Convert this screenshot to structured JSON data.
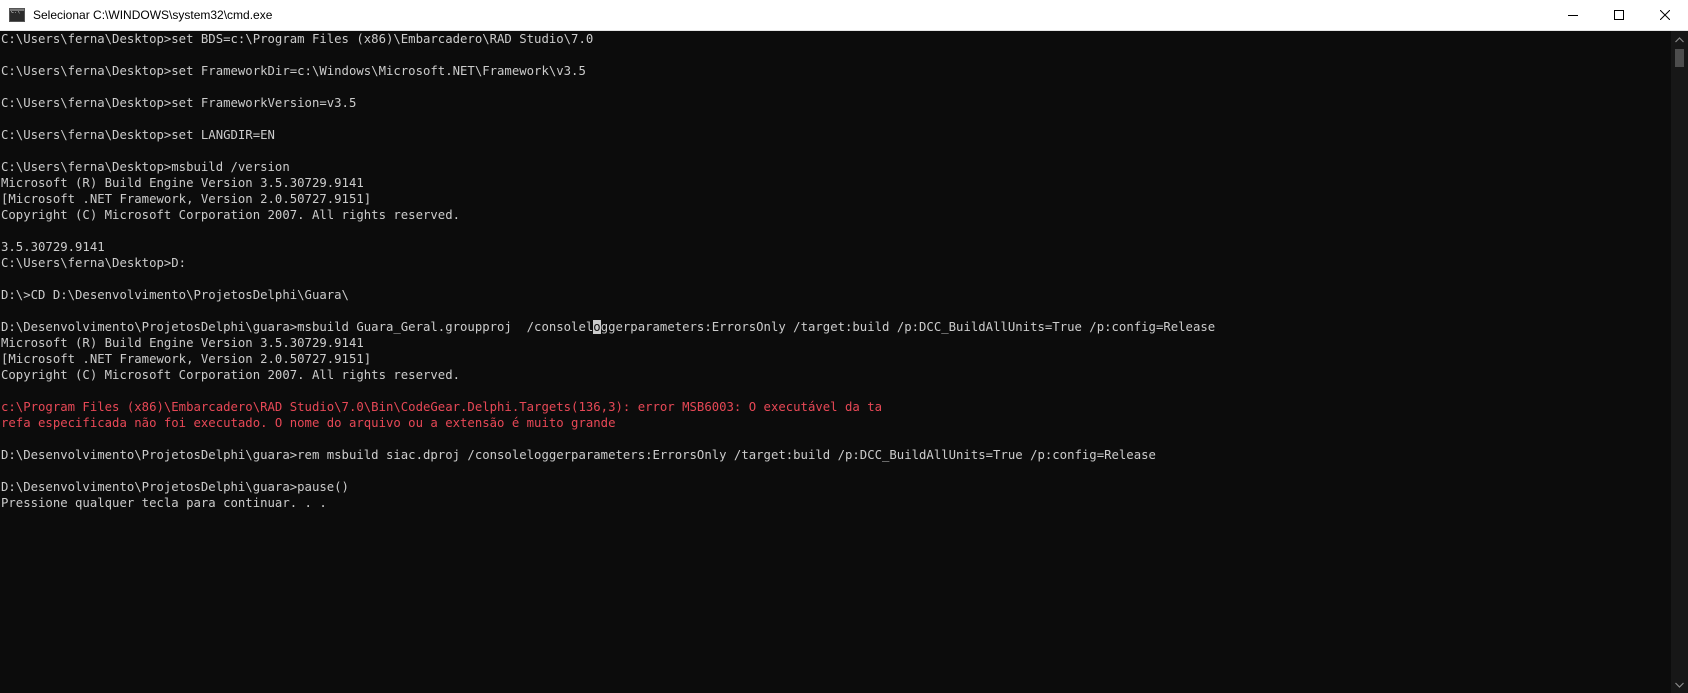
{
  "window": {
    "title": "Selecionar C:\\WINDOWS\\system32\\cmd.exe",
    "icon": "cmd-icon"
  },
  "colors": {
    "console_bg": "#0c0c0c",
    "console_fg": "#cccccc",
    "error_fg": "#e74856",
    "titlebar_bg": "#ffffff"
  },
  "console": {
    "lines": [
      {
        "text": "C:\\Users\\ferna\\Desktop>set BDS=c:\\Program Files (x86)\\Embarcadero\\RAD Studio\\7.0",
        "type": "normal"
      },
      {
        "text": "",
        "type": "normal"
      },
      {
        "text": "C:\\Users\\ferna\\Desktop>set FrameworkDir=c:\\Windows\\Microsoft.NET\\Framework\\v3.5",
        "type": "normal"
      },
      {
        "text": "",
        "type": "normal"
      },
      {
        "text": "C:\\Users\\ferna\\Desktop>set FrameworkVersion=v3.5",
        "type": "normal"
      },
      {
        "text": "",
        "type": "normal"
      },
      {
        "text": "C:\\Users\\ferna\\Desktop>set LANGDIR=EN",
        "type": "normal"
      },
      {
        "text": "",
        "type": "normal"
      },
      {
        "text": "C:\\Users\\ferna\\Desktop>msbuild /version",
        "type": "normal"
      },
      {
        "text": "Microsoft (R) Build Engine Version 3.5.30729.9141",
        "type": "normal"
      },
      {
        "text": "[Microsoft .NET Framework, Version 2.0.50727.9151]",
        "type": "normal"
      },
      {
        "text": "Copyright (C) Microsoft Corporation 2007. All rights reserved.",
        "type": "normal"
      },
      {
        "text": "",
        "type": "normal"
      },
      {
        "text": "3.5.30729.9141",
        "type": "normal"
      },
      {
        "text": "C:\\Users\\ferna\\Desktop>D:",
        "type": "normal"
      },
      {
        "text": "",
        "type": "normal"
      },
      {
        "text": "D:\\>CD D:\\Desenvolvimento\\ProjetosDelphi\\Guara\\",
        "type": "normal"
      },
      {
        "text": "",
        "type": "normal"
      },
      {
        "text": "D:\\Desenvolvimento\\ProjetosDelphi\\guara>msbuild Guara_Geral.groupproj  /consoleloggerparameters:ErrorsOnly /target:build /p:DCC_BuildAllUnits=True /p:config=Release",
        "type": "cursor",
        "before": "D:\\Desenvolvimento\\ProjetosDelphi\\guara>msbuild Guara_Geral.groupproj  /consolel",
        "cursor": "o",
        "after": "ggerparameters:ErrorsOnly /target:build /p:DCC_BuildAllUnits=True /p:config=Release"
      },
      {
        "text": "Microsoft (R) Build Engine Version 3.5.30729.9141",
        "type": "normal"
      },
      {
        "text": "[Microsoft .NET Framework, Version 2.0.50727.9151]",
        "type": "normal"
      },
      {
        "text": "Copyright (C) Microsoft Corporation 2007. All rights reserved.",
        "type": "normal"
      },
      {
        "text": "",
        "type": "normal"
      },
      {
        "text": "c:\\Program Files (x86)\\Embarcadero\\RAD Studio\\7.0\\Bin\\CodeGear.Delphi.Targets(136,3): error MSB6003: O executável da ta",
        "type": "error"
      },
      {
        "text": "refa especificada não foi executado. O nome do arquivo ou a extensão é muito grande",
        "type": "error"
      },
      {
        "text": "",
        "type": "normal"
      },
      {
        "text": "D:\\Desenvolvimento\\ProjetosDelphi\\guara>rem msbuild siac.dproj /consoleloggerparameters:ErrorsOnly /target:build /p:DCC_BuildAllUnits=True /p:config=Release",
        "type": "normal"
      },
      {
        "text": "",
        "type": "normal"
      },
      {
        "text": "D:\\Desenvolvimento\\ProjetosDelphi\\guara>pause()",
        "type": "normal"
      },
      {
        "text": "Pressione qualquer tecla para continuar. . .",
        "type": "normal"
      }
    ]
  }
}
